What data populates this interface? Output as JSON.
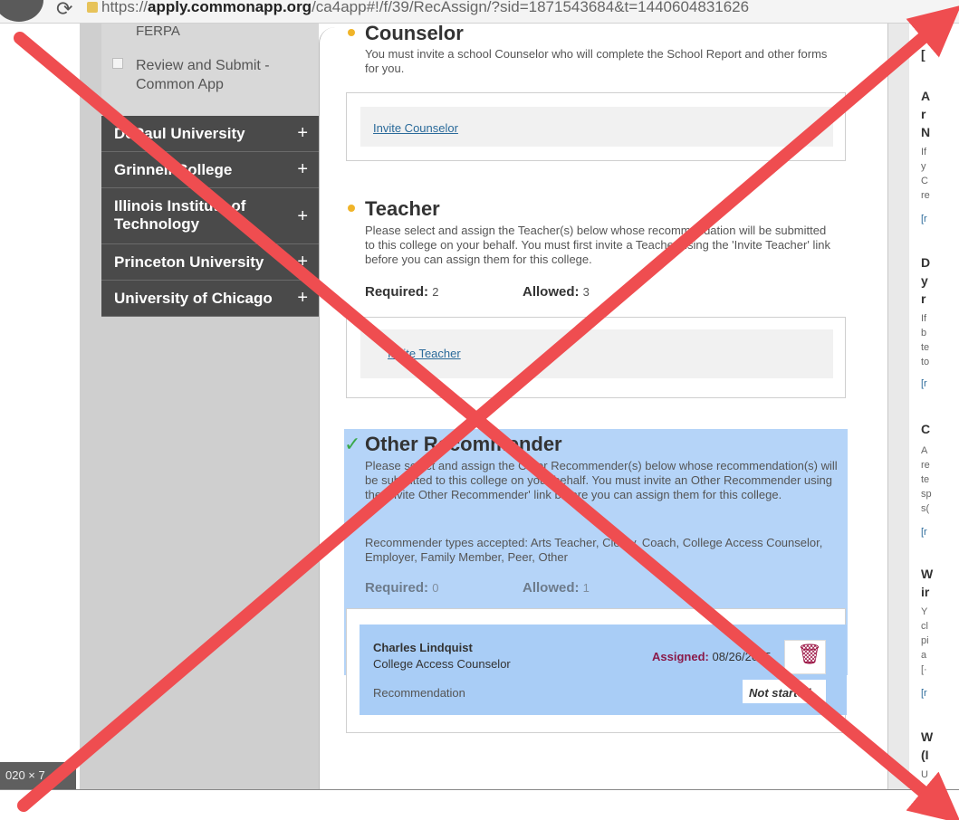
{
  "browser": {
    "url_prefix": "https://",
    "url_domain": "apply.commonapp.org",
    "url_rest": "/ca4app#!/f/39/RecAssign/?sid=1871543684&t=1440604831626",
    "reload_icon": "reload-icon"
  },
  "sidebar": {
    "ferpa": "FERPA",
    "review_submit": "Review and Submit - Common App",
    "colleges": [
      {
        "label": "DePaul University",
        "plus": "+"
      },
      {
        "label": "Grinnell College",
        "plus": "+"
      },
      {
        "label": "Illinois Institute of Technology",
        "plus": "+"
      },
      {
        "label": "Princeton University",
        "plus": "+"
      },
      {
        "label": "University of Chicago",
        "plus": "+"
      }
    ]
  },
  "counselor": {
    "title": "Counselor",
    "description": "You must invite a school Counselor who will complete the School Report and other forms for you.",
    "link": "Invite Counselor"
  },
  "teacher": {
    "title": "Teacher",
    "description": "Please select and assign the Teacher(s) below whose recommendation will be submitted to this college on your behalf. You must first invite a Teacher using the 'Invite Teacher' link before you can assign them for this college.",
    "required_label": "Required:",
    "required_value": "2",
    "allowed_label": "Allowed:",
    "allowed_value": "3",
    "link": "Invite Teacher"
  },
  "other": {
    "title": "Other Recommender",
    "description": "Please select and assign the Other Recommender(s) below whose recommendation(s) will be submitted to this college on your behalf. You must invite an Other Recommender using the 'Invite Other Recommender' link before you can assign them for this college.",
    "types": "Recommender types accepted: Arts Teacher, Clergy, Coach, College Access Counselor, Employer, Family Member, Peer, Other",
    "required_label": "Required:",
    "required_value": "0",
    "allowed_label": "Allowed:",
    "allowed_value": "1",
    "recommender_name": "Charles Lindquist",
    "recommender_role": "College Access Counselor",
    "assigned_label": "Assigned:",
    "assigned_date": "08/26/2015",
    "rec_label": "Recommendation",
    "rec_status": "Not started",
    "delete_icon": "trash-icon"
  },
  "right_panel": {
    "f1": "[",
    "f2": "A",
    "f3": "r",
    "f4": "N",
    "s1": "If",
    "s2": "y",
    "s3": "C",
    "s4": "re",
    "l1": "[r",
    "f5": "D",
    "f6": "y",
    "f7": "r",
    "s5": "If",
    "s6": "b",
    "s7": "te",
    "s8": "to",
    "l2": "[r",
    "f8": "C",
    "s9": "A",
    "s10": "re",
    "s11": "te",
    "s12": "sp",
    "s13": "s(",
    "l3": "[r",
    "f9": "W",
    "f10": "ir",
    "s14": "Y",
    "s15": "cl",
    "s16": "pi",
    "s17": "a",
    "s18": "[·",
    "l4": "[r",
    "f11": "W",
    "f12": "(I",
    "s19": "U"
  },
  "size_badge": "020 × 7",
  "colors": {
    "sidebar_dark": "#4a4a4a",
    "highlight": "#b5d4f8",
    "bullet": "#f0b429",
    "check": "#3aa84a",
    "x_mark": "#ef4d50"
  }
}
